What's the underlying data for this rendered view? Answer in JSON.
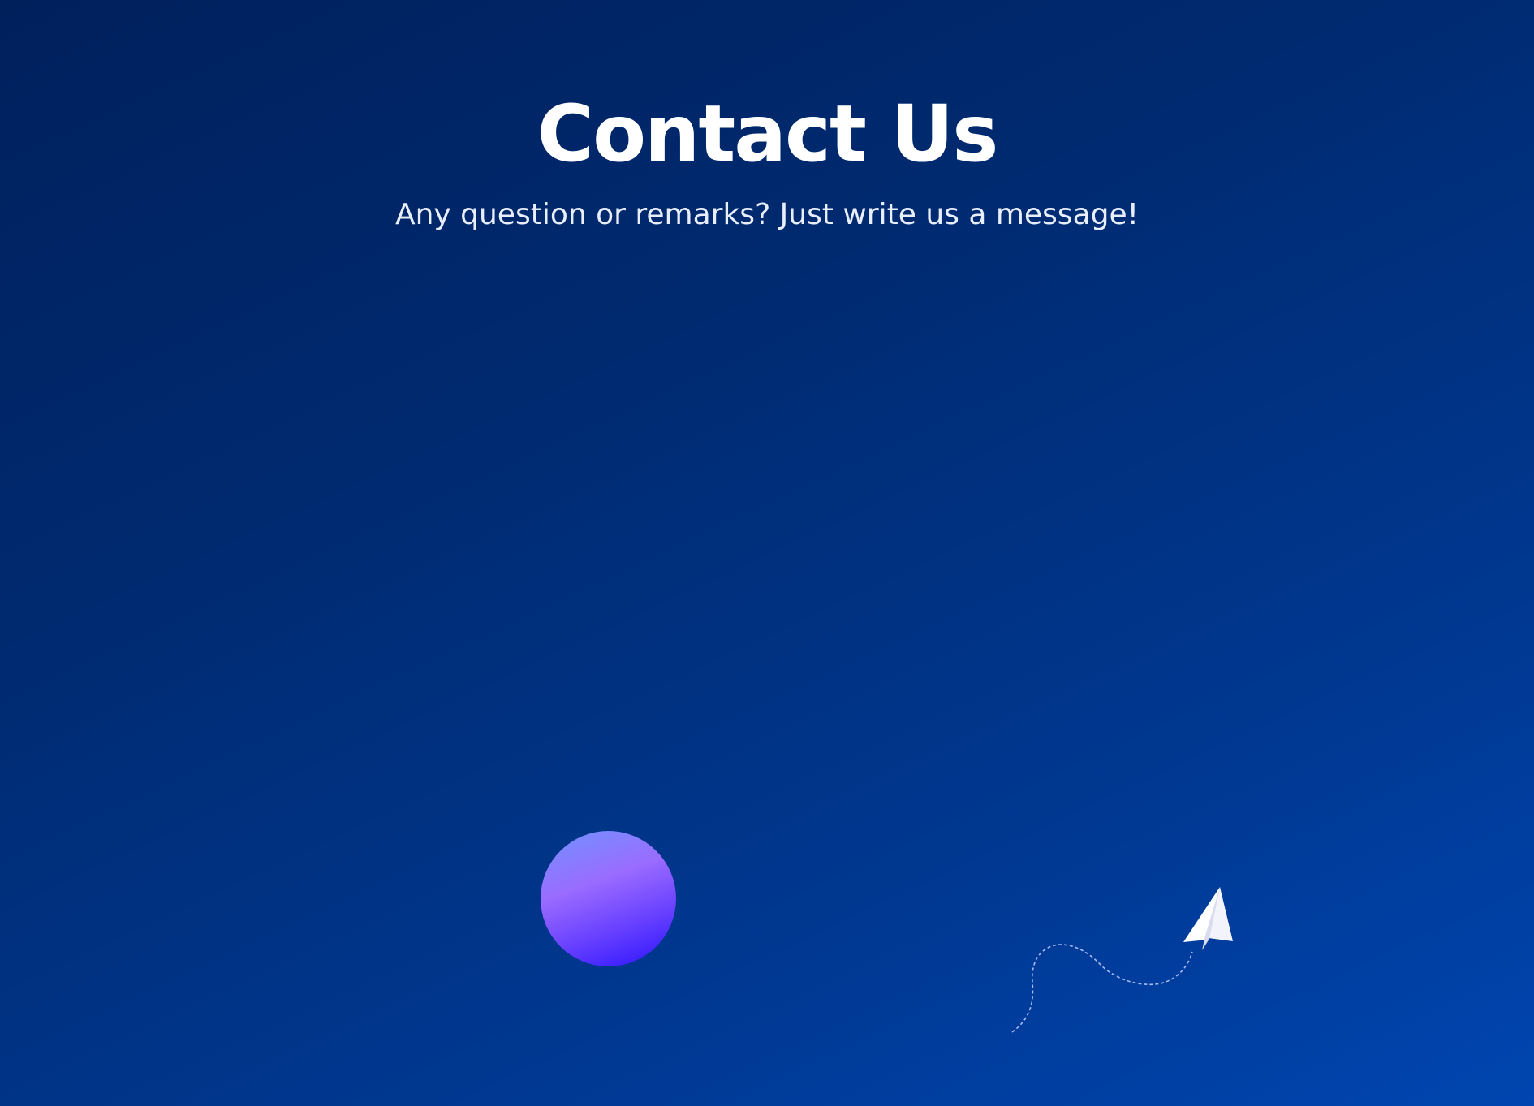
{
  "header": {
    "title": "Contact Us",
    "subtitle": "Any question or remarks? Just write us a message!"
  },
  "decorations": {
    "orb": "gradient-circle-decoration",
    "plane": "paper-plane-icon"
  },
  "colors": {
    "background_start": "#00205c",
    "background_end": "#0045b0",
    "title": "#ffffff",
    "subtitle": "#e9eefc",
    "orb_top": "#6f93ff",
    "orb_mid": "#9a6cff",
    "orb_bottom": "#2a12ff"
  }
}
